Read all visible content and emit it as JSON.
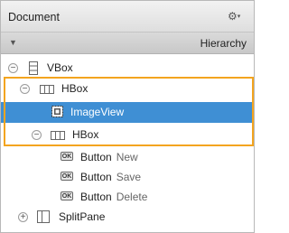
{
  "panel": {
    "title": "Document",
    "gear_icon": "gear-icon",
    "hierarchy_label": "Hierarchy"
  },
  "tree": {
    "vbox": {
      "type": "VBox",
      "icon": "vbox-icon"
    },
    "hbox1": {
      "type": "HBox",
      "icon": "hbox-icon"
    },
    "imageview": {
      "type": "ImageView",
      "icon": "imageview-icon"
    },
    "hbox2": {
      "type": "HBox",
      "icon": "hbox-icon"
    },
    "buttons": [
      {
        "type": "Button",
        "text": "New"
      },
      {
        "type": "Button",
        "text": "Save"
      },
      {
        "type": "Button",
        "text": "Delete"
      }
    ],
    "splitpane": {
      "type": "SplitPane",
      "icon": "splitpane-icon"
    }
  },
  "colors": {
    "selection": "#3f8fd4",
    "highlight_border": "#f3a41f"
  },
  "selected_item": "ImageView"
}
